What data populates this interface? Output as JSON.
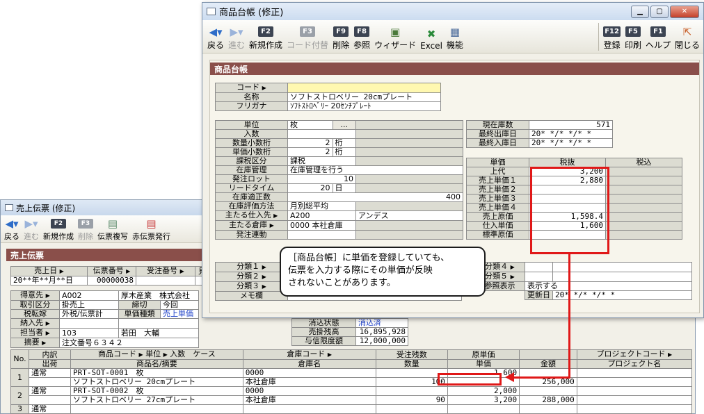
{
  "back": {
    "title": "売上伝票 (修正)",
    "toolbar": [
      {
        "label": "戻る",
        "icon": "back-arrow-icon"
      },
      {
        "label": "進む",
        "icon": "forward-arrow-icon",
        "disabled": true
      },
      {
        "key": "F2",
        "label": "新規作成"
      },
      {
        "key": "F3",
        "label": "削除",
        "disabled": true
      },
      {
        "label": "伝票複写",
        "icon": "copy-slip-icon"
      },
      {
        "label": "赤伝票発行",
        "icon": "red-slip-icon"
      }
    ],
    "section": "売上伝票",
    "header": {
      "date_label": "売上日",
      "date_value": "20**年**月**日",
      "slip_no_label": "伝票番号",
      "slip_no_value": "00000038",
      "order_no_label": "受注番号",
      "estimate_label": "見"
    },
    "customer": {
      "customer_label": "得意先",
      "customer_code": "A002",
      "customer_name": "厚木産業　株式会社",
      "trade_label": "取引区分",
      "trade_value": "掛売上",
      "close_label": "締切",
      "close_value": "今回",
      "tax_label": "税転嫁",
      "tax_value": "外税/伝票計",
      "price_type_label": "単価種類",
      "price_type_value": "売上単価",
      "delivery_label": "納入先",
      "staff_label": "担当者",
      "staff_code": "103",
      "staff_name": "若田　大輔",
      "memo_label": "摘要",
      "memo_value": "注文番号６３４２",
      "settle_label": "消込状態",
      "settle_value": "消込済",
      "balance_label": "売掛残高",
      "balance_value": "16,895,928",
      "credit_label": "与信限度額",
      "credit_value": "12,000,000"
    },
    "grid_headers": {
      "no": "No.",
      "detail": "内訳",
      "ship": "出荷",
      "code": "商品コード",
      "name": "商品名/摘要",
      "unit": "単位",
      "qty_per": "入数",
      "case": "ケース",
      "wh_code": "倉庫コード",
      "wh_name": "倉庫名",
      "remain": "受注残数",
      "qty": "数量",
      "cost": "原単価",
      "price": "単価",
      "amount": "金額",
      "proj_code": "プロジェクトコード",
      "proj_name": "プロジェクト名"
    },
    "rows": [
      {
        "no": "1",
        "type": "通常",
        "code": "PRT-SOT-0001",
        "unit": "枚",
        "name": "ソフトストロベリー 20cmプレート",
        "wh_code": "0000",
        "wh_name": "本社倉庫",
        "qty": "100",
        "cost": "1,600",
        "price": "",
        "amount": "256,000"
      },
      {
        "no": "2",
        "type": "通常",
        "code": "PRT-SOT-0002",
        "unit": "枚",
        "name": "ソフトストロベリー 27cmプレート",
        "wh_code": "0000",
        "wh_name": "本社倉庫",
        "qty": "90",
        "cost": "2,000",
        "price": "3,200",
        "amount": "288,000"
      },
      {
        "no": "3",
        "type": "通常",
        "code": "",
        "unit": "",
        "name": "",
        "wh_code": "",
        "wh_name": "",
        "qty": "",
        "cost": "",
        "price": "",
        "amount": ""
      }
    ]
  },
  "front": {
    "title": "商品台帳 (修正)",
    "toolbar_left": [
      {
        "label": "戻る",
        "icon": "back-arrow-icon"
      },
      {
        "label": "進む",
        "icon": "forward-arrow-icon",
        "disabled": true
      },
      {
        "key": "F2",
        "label": "新規作成"
      },
      {
        "key": "F3",
        "label": "コード付替",
        "disabled": true
      },
      {
        "key": "F9",
        "label": "削除"
      },
      {
        "key": "F8",
        "label": "参照"
      },
      {
        "label": "ウィザード",
        "icon": "wizard-icon"
      },
      {
        "label": "Excel",
        "icon": "excel-icon"
      },
      {
        "label": "機能",
        "icon": "function-icon"
      }
    ],
    "toolbar_right": [
      {
        "key": "F12",
        "label": "登録"
      },
      {
        "key": "F5",
        "label": "印刷"
      },
      {
        "key": "F1",
        "label": "ヘルプ"
      },
      {
        "label": "閉じる",
        "icon": "exit-door-icon"
      }
    ],
    "section": "商品台帳",
    "code_label": "コード",
    "code_value": "",
    "name_label": "名称",
    "name_value": "ソフトストロベリー 20cmプレート",
    "kana_label": "フリガナ",
    "kana_value": "ｿﾌﾄｽﾄﾛﾍﾞﾘｰ 20ｾﾝﾁﾌﾟﾚｰﾄ",
    "fields": [
      {
        "label": "単位",
        "value": "枚",
        "has_button": true,
        "button": "..."
      },
      {
        "label": "入数",
        "value": ""
      },
      {
        "label": "数量小数桁",
        "value": "2",
        "suffix": "桁"
      },
      {
        "label": "単価小数桁",
        "value": "2",
        "suffix": "桁"
      },
      {
        "label": "課税区分",
        "value": "課税"
      },
      {
        "label": "在庫管理",
        "value": "在庫管理を行う"
      },
      {
        "label": "発注ロット",
        "value": "10",
        "right": true
      },
      {
        "label": "リードタイム",
        "value": "20",
        "suffix": "日"
      },
      {
        "label": "在庫適正数",
        "value": "400",
        "right": true
      },
      {
        "label": "在庫評価方法",
        "value": "月別総平均"
      },
      {
        "label": "主たる仕入先",
        "value": "A200",
        "extra": "アンデス"
      },
      {
        "label": "主たる倉庫",
        "value": "0000",
        "extra": "本社倉庫"
      },
      {
        "label": "発注連動",
        "value": ""
      }
    ],
    "stock": [
      {
        "label": "現在庫数",
        "value": "571"
      },
      {
        "label": "最終出庫日",
        "value": "20* */* */* *"
      },
      {
        "label": "最終入庫日",
        "value": "20* */* */* *"
      }
    ],
    "price_header": {
      "col1": "単価",
      "col2": "税抜",
      "col3": "税込"
    },
    "prices": [
      {
        "label": "上代",
        "value": "3,200"
      },
      {
        "label": "売上単価１",
        "value": "2,880"
      },
      {
        "label": "売上単価２",
        "value": ""
      },
      {
        "label": "売上単価３",
        "value": ""
      },
      {
        "label": "売上単価４",
        "value": ""
      },
      {
        "label": "売上原価",
        "value": "1,598.4"
      },
      {
        "label": "仕入単価",
        "value": "1,600"
      },
      {
        "label": "標準原価",
        "value": ""
      }
    ],
    "categories": [
      {
        "label": "分類１"
      },
      {
        "label": "分類２"
      },
      {
        "label": "分類３"
      }
    ],
    "categories_right": [
      {
        "label": "分類４"
      },
      {
        "label": "分類５"
      }
    ],
    "ref_label": "参照表示",
    "ref_value": "表示する",
    "memo_label": "メモ欄",
    "updated_label": "更新日",
    "updated_value": "20* */* */* *"
  },
  "callout": {
    "line1": "［商品台帳］に単価を登録していても、",
    "line2": "伝票を入力する際にその単価が反映",
    "line3": "されないことがあります。"
  },
  "colors": {
    "section": "#8a4f4a",
    "highlight": "#e01818",
    "code_field": "#fff8b0"
  }
}
